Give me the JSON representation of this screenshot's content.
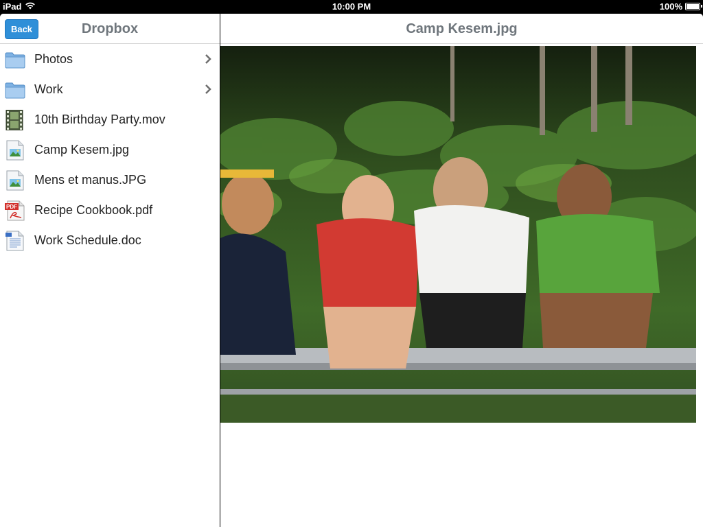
{
  "status_bar": {
    "device": "iPad",
    "time": "10:00 PM",
    "battery": "100%"
  },
  "master": {
    "back_label": "Back",
    "title": "Dropbox",
    "items": [
      {
        "label": "Photos",
        "icon": "folder-icon",
        "has_chevron": true
      },
      {
        "label": "Work",
        "icon": "folder-icon",
        "has_chevron": true
      },
      {
        "label": "10th Birthday Party.mov",
        "icon": "video-file-icon",
        "has_chevron": false
      },
      {
        "label": "Camp Kesem.jpg",
        "icon": "image-file-icon",
        "has_chevron": false
      },
      {
        "label": "Mens et manus.JPG",
        "icon": "image-file-icon",
        "has_chevron": false
      },
      {
        "label": "Recipe Cookbook.pdf",
        "icon": "pdf-file-icon",
        "has_chevron": false
      },
      {
        "label": "Work Schedule.doc",
        "icon": "doc-file-icon",
        "has_chevron": false
      }
    ]
  },
  "detail": {
    "title": "Camp Kesem.jpg"
  },
  "colors": {
    "accent": "#2f8fd8",
    "title_gray": "#6f767c"
  }
}
